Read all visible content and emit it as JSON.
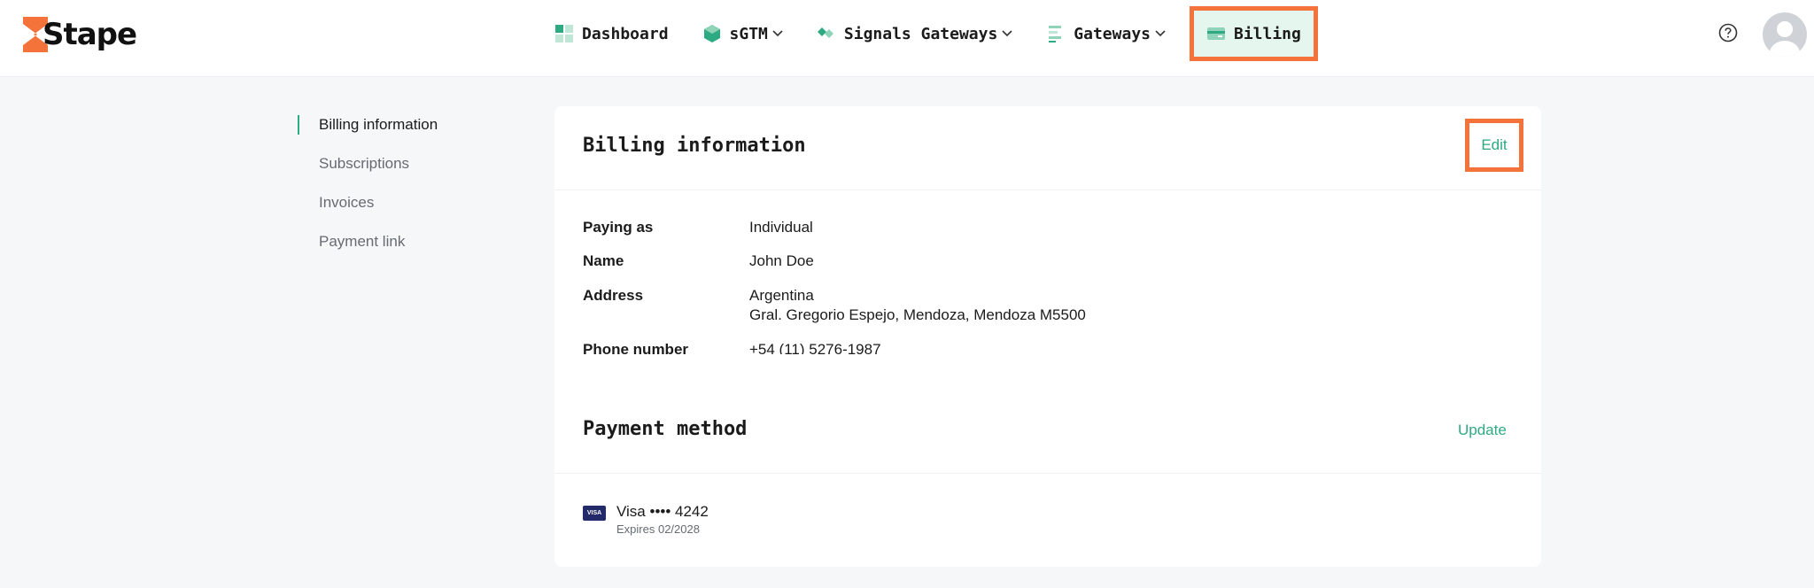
{
  "brand": {
    "name": "Stape",
    "accent": "#f3733a",
    "green": "#2eaa82"
  },
  "nav": {
    "items": [
      {
        "label": "Dashboard",
        "icon": "dashboard-icon",
        "dropdown": false
      },
      {
        "label": "sGTM",
        "icon": "cube-icon",
        "dropdown": true
      },
      {
        "label": "Signals Gateways",
        "icon": "signals-icon",
        "dropdown": true
      },
      {
        "label": "Gateways",
        "icon": "gateways-icon",
        "dropdown": true
      },
      {
        "label": "Billing",
        "icon": "credit-card-icon",
        "dropdown": false,
        "active": true
      }
    ]
  },
  "sidebar": {
    "items": [
      {
        "label": "Billing information",
        "active": true
      },
      {
        "label": "Subscriptions"
      },
      {
        "label": "Invoices"
      },
      {
        "label": "Payment link"
      }
    ]
  },
  "billing": {
    "title": "Billing information",
    "edit_label": "Edit",
    "fields": {
      "paying_as": {
        "key": "Paying as",
        "value": "Individual"
      },
      "name": {
        "key": "Name",
        "value": "John Doe"
      },
      "address": {
        "key": "Address",
        "line1": "Argentina",
        "line2": "Gral. Gregorio Espejo, Mendoza, Mendoza M5500"
      },
      "phone": {
        "key": "Phone number",
        "value": "+54 (11) 5276-1987"
      }
    }
  },
  "payment": {
    "title": "Payment method",
    "update_label": "Update",
    "card_brand": "VISA",
    "card_number": "Visa •••• 4242",
    "expires": "Expires 02/2028"
  }
}
